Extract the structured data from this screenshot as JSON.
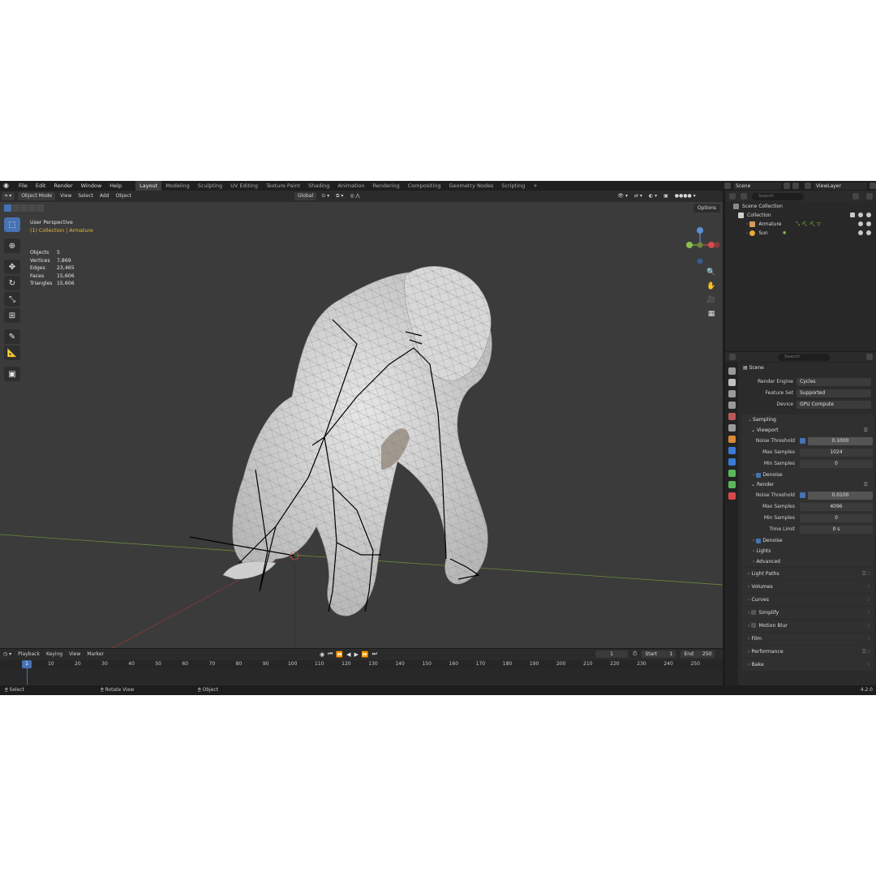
{
  "menu": [
    "File",
    "Edit",
    "Render",
    "Window",
    "Help"
  ],
  "workspaces": [
    "Layout",
    "Modeling",
    "Sculpting",
    "UV Editing",
    "Texture Paint",
    "Shading",
    "Animation",
    "Rendering",
    "Compositing",
    "Geometry Nodes",
    "Scripting"
  ],
  "active_workspace": "Layout",
  "scene_name": "Scene",
  "view_layer": "ViewLayer",
  "viewport": {
    "mode": "Object Mode",
    "menus": [
      "View",
      "Select",
      "Add",
      "Object"
    ],
    "transform_orientation": "Global",
    "options_label": "Options",
    "perspective": "User Perspective",
    "collection_label": "(1) Collection | Armature",
    "stats": [
      {
        "k": "Objects",
        "v": "5"
      },
      {
        "k": "Vertices",
        "v": "7,869"
      },
      {
        "k": "Edges",
        "v": "23,465"
      },
      {
        "k": "Faces",
        "v": "15,606"
      },
      {
        "k": "Triangles",
        "v": "15,606"
      }
    ]
  },
  "timeline": {
    "menus": [
      "Playback",
      "Keying",
      "View",
      "Marker"
    ],
    "current_frame": "1",
    "start_label": "Start",
    "start": "1",
    "end_label": "End",
    "end": "250",
    "ticks": [
      "10",
      "20",
      "30",
      "40",
      "50",
      "60",
      "70",
      "80",
      "90",
      "100",
      "110",
      "120",
      "130",
      "140",
      "150",
      "160",
      "170",
      "180",
      "190",
      "200",
      "210",
      "220",
      "230",
      "240",
      "250"
    ]
  },
  "status": {
    "select": "Select",
    "rotate": "Rotate View",
    "object": "Object",
    "version": "4.2.0"
  },
  "outliner": {
    "search_placeholder": "Search",
    "scene_collection": "Scene Collection",
    "collection": "Collection",
    "armature": "Armature",
    "sun": "Sun"
  },
  "properties": {
    "search_placeholder": "Search",
    "breadcrumb": "Scene",
    "render_engine_label": "Render Engine",
    "render_engine": "Cycles",
    "feature_set_label": "Feature Set",
    "feature_set": "Supported",
    "device_label": "Device",
    "device": "GPU Compute",
    "sampling": "Sampling",
    "viewport": "Viewport",
    "noise_threshold_label": "Noise Threshold",
    "vp_noise_threshold": "0.1000",
    "max_samples_label": "Max Samples",
    "vp_max_samples": "1024",
    "min_samples_label": "Min Samples",
    "vp_min_samples": "0",
    "denoise": "Denoise",
    "render": "Render",
    "r_noise_threshold": "0.0100",
    "r_max_samples": "4096",
    "r_min_samples": "0",
    "time_limit_label": "Time Limit",
    "r_time_limit": "0 s",
    "lights": "Lights",
    "advanced": "Advanced",
    "panels": [
      "Light Paths",
      "Volumes",
      "Curves",
      "Simplify",
      "Motion Blur",
      "Film",
      "Performance",
      "Bake"
    ]
  },
  "colors": {
    "accent": "#4772b3",
    "collection_text": "#e8b93a",
    "viewport_bg": "#3b3b3b"
  }
}
